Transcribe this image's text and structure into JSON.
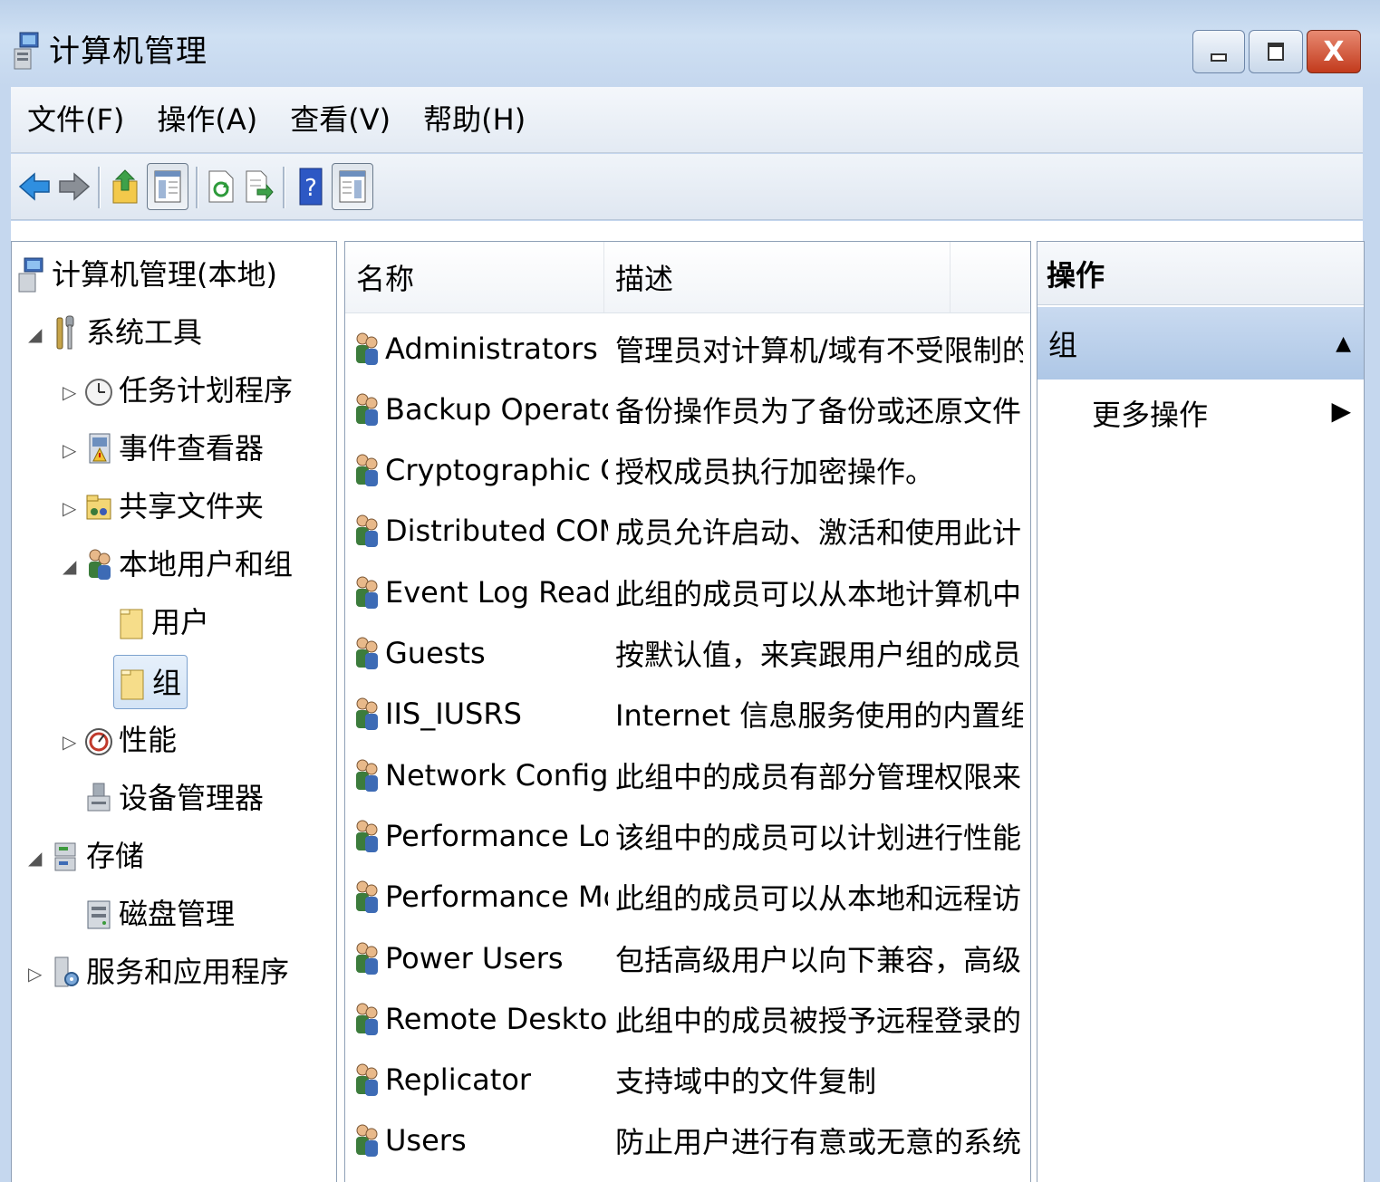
{
  "window": {
    "title": "计算机管理",
    "buttons": {
      "minimize": "",
      "maximize": "",
      "close": "X"
    }
  },
  "menu": [
    "文件(F)",
    "操作(A)",
    "查看(V)",
    "帮助(H)"
  ],
  "toolbar": {
    "icons": [
      "back-arrow-icon",
      "forward-arrow-icon",
      "up-level-icon",
      "show-hide-tree-icon",
      "refresh-icon",
      "export-list-icon",
      "help-icon",
      "show-hide-action-pane-icon"
    ]
  },
  "tree": {
    "root": "计算机管理(本地)",
    "system_tools": "系统工具",
    "task_scheduler": "任务计划程序",
    "event_viewer": "事件查看器",
    "shared_folders": "共享文件夹",
    "local_users_groups": "本地用户和组",
    "users": "用户",
    "groups": "组",
    "performance": "性能",
    "device_manager": "设备管理器",
    "storage": "存储",
    "disk_management": "磁盘管理",
    "services_apps": "服务和应用程序"
  },
  "list": {
    "columns": [
      "名称",
      "描述"
    ],
    "rows": [
      {
        "name": "Administrators",
        "desc": "管理员对计算机/域有不受限制的..."
      },
      {
        "name": "Backup Operators",
        "desc": "备份操作员为了备份或还原文件..."
      },
      {
        "name": "Cryptographic Oper...",
        "desc": "授权成员执行加密操作。"
      },
      {
        "name": "Distributed COM Us...",
        "desc": "成员允许启动、激活和使用此计..."
      },
      {
        "name": "Event Log Readers",
        "desc": "此组的成员可以从本地计算机中..."
      },
      {
        "name": "Guests",
        "desc": "按默认值，来宾跟用户组的成员..."
      },
      {
        "name": "IIS_IUSRS",
        "desc": "Internet 信息服务使用的内置组。"
      },
      {
        "name": "Network Configurat...",
        "desc": "此组中的成员有部分管理权限来..."
      },
      {
        "name": "Performance Log U...",
        "desc": "该组中的成员可以计划进行性能..."
      },
      {
        "name": "Performance Monit...",
        "desc": "此组的成员可以从本地和远程访..."
      },
      {
        "name": "Power Users",
        "desc": "包括高级用户以向下兼容，高级..."
      },
      {
        "name": "Remote Desktop Us...",
        "desc": "此组中的成员被授予远程登录的..."
      },
      {
        "name": "Replicator",
        "desc": "支持域中的文件复制"
      },
      {
        "name": "Users",
        "desc": "防止用户进行有意或无意的系统..."
      }
    ]
  },
  "actions": {
    "title": "操作",
    "section": "组",
    "more": "更多操作"
  }
}
